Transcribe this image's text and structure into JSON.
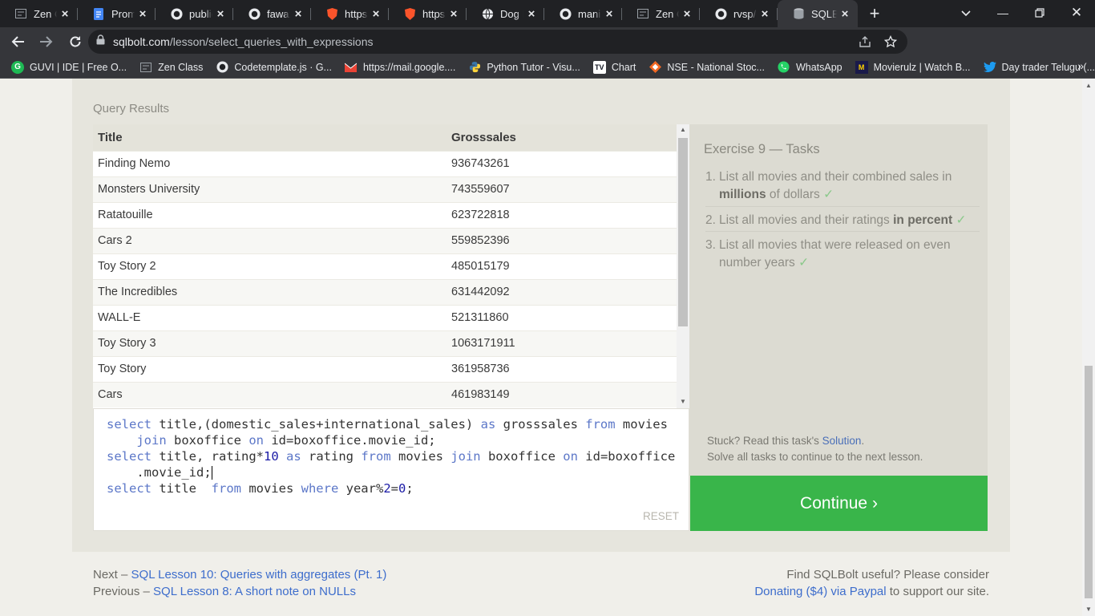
{
  "tabs": [
    {
      "title": "Zen Cl",
      "icon": "zen-icon"
    },
    {
      "title": "Promis",
      "icon": "docs-icon"
    },
    {
      "title": "public",
      "icon": "github-icon"
    },
    {
      "title": "fawaz",
      "icon": "github-icon"
    },
    {
      "title": "https:/",
      "icon": "brave-icon"
    },
    {
      "title": "https:/",
      "icon": "brave-icon"
    },
    {
      "title": "Dog Fa",
      "icon": "globe-icon"
    },
    {
      "title": "manik",
      "icon": "github-icon"
    },
    {
      "title": "Zen Cl",
      "icon": "zen-icon"
    },
    {
      "title": "rvsp/d",
      "icon": "github-icon"
    },
    {
      "title": "SQLBo",
      "icon": "database-icon",
      "active": true
    }
  ],
  "address": {
    "host": "sqlbolt.com",
    "path": "/lesson/select_queries_with_expressions"
  },
  "bookmarks": [
    {
      "label": "GUVI | IDE | Free O...",
      "icon": "guvi-icon"
    },
    {
      "label": "Zen Class",
      "icon": "zen-icon"
    },
    {
      "label": "Codetemplate.js · G...",
      "icon": "github-icon"
    },
    {
      "label": "https://mail.google....",
      "icon": "gmail-icon"
    },
    {
      "label": "Python Tutor - Visu...",
      "icon": "python-icon"
    },
    {
      "label": "Chart",
      "icon": "tradingview-icon"
    },
    {
      "label": "NSE - National Stoc...",
      "icon": "nse-icon"
    },
    {
      "label": "WhatsApp",
      "icon": "whatsapp-icon"
    },
    {
      "label": "Movierulz | Watch B...",
      "icon": "movierulz-icon"
    },
    {
      "label": "Day trader Telugu (...",
      "icon": "twitter-icon"
    }
  ],
  "query_results": {
    "label": "Query Results",
    "headers": [
      "Title",
      "Grosssales"
    ],
    "rows": [
      [
        "Finding Nemo",
        "936743261"
      ],
      [
        "Monsters University",
        "743559607"
      ],
      [
        "Ratatouille",
        "623722818"
      ],
      [
        "Cars 2",
        "559852396"
      ],
      [
        "Toy Story 2",
        "485015179"
      ],
      [
        "The Incredibles",
        "631442092"
      ],
      [
        "WALL-E",
        "521311860"
      ],
      [
        "Toy Story 3",
        "1063171911"
      ],
      [
        "Toy Story",
        "361958736"
      ],
      [
        "Cars",
        "461983149"
      ]
    ]
  },
  "editor": {
    "reset_label": "RESET",
    "code": "select title,(domestic_sales+international_sales) as grosssales from movies join boxoffice on id=boxoffice.movie_id;\nselect title, rating*10 as rating from movies join boxoffice on id=boxoffice.movie_id;\nselect title  from movies where year%2=0;"
  },
  "tasks": {
    "title": "Exercise 9 — Tasks",
    "items": [
      {
        "num": "1.",
        "pre": "List all movies and their combined sales in ",
        "bold": "millions",
        "post": " of dollars",
        "done": "✓"
      },
      {
        "num": "2.",
        "pre": "List all movies and their ratings ",
        "bold": "in percent",
        "post": "",
        "done": "✓"
      },
      {
        "num": "3.",
        "pre": "List all movies that were released on even number years",
        "bold": "",
        "post": "",
        "done": "✓"
      }
    ],
    "stuck_pre": "Stuck? Read this task's ",
    "solution_link": "Solution",
    "stuck_post": ".",
    "solve_all": "Solve all tasks to continue to the next lesson."
  },
  "continue_label": "Continue ›",
  "footer": {
    "next_prefix": "Next – ",
    "next_link": "SQL Lesson 10: Queries with aggregates (Pt. 1)",
    "prev_prefix": "Previous – ",
    "prev_link": "SQL Lesson 8: A short note on NULLs",
    "useful": "Find SQLBolt useful? Please consider",
    "donate_link": "Donating ($4) via Paypal",
    "donate_post": " to support our site."
  },
  "colors": {
    "continue": "#39b54a",
    "keyword": "#5c77c8",
    "link": "#3d6dcc"
  }
}
